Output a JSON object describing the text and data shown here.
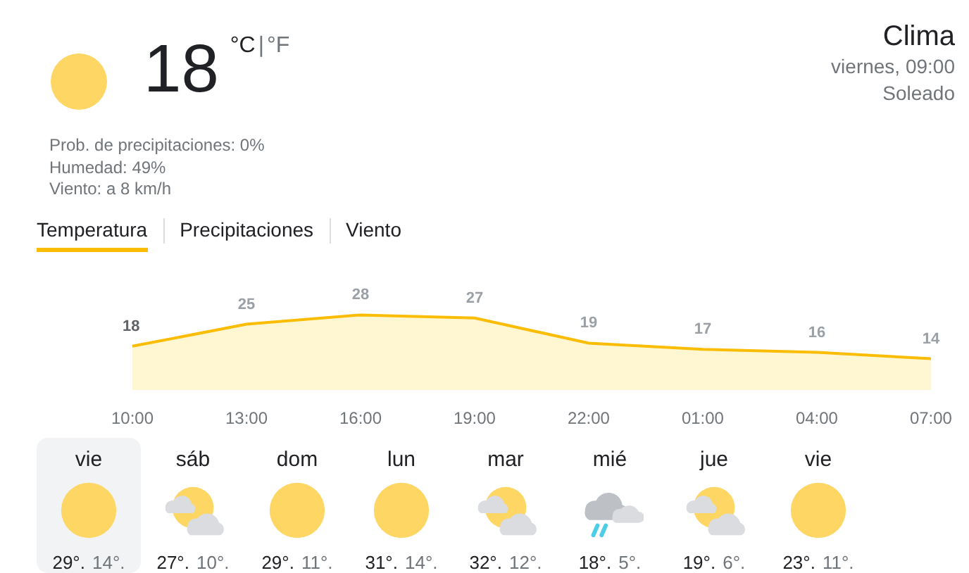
{
  "current": {
    "kind": "sun",
    "temperature": "18",
    "unit_c": "°C",
    "separator": "|",
    "unit_f": "°F",
    "details": [
      "Prob. de precipitaciones: 0%",
      "Humedad: 49%",
      "Viento: a 8 km/h"
    ]
  },
  "location": {
    "title": "Clima",
    "time": "viernes, 09:00",
    "condition": "Soleado"
  },
  "tabs": [
    {
      "label": "Temperatura",
      "selected": true
    },
    {
      "label": "Precipitaciones",
      "selected": false
    },
    {
      "label": "Viento",
      "selected": false
    }
  ],
  "chart_data": {
    "type": "area",
    "categories": [
      "10:00",
      "13:00",
      "16:00",
      "19:00",
      "22:00",
      "01:00",
      "04:00",
      "07:00"
    ],
    "values": [
      18,
      25,
      28,
      27,
      19,
      17,
      16,
      14
    ],
    "data_labels": true
  },
  "days": [
    {
      "day": "vie",
      "kind": "sun",
      "high": "29°.",
      "low": "14°.",
      "selected": true
    },
    {
      "day": "sáb",
      "kind": "partly-cloudy",
      "high": "27°.",
      "low": "10°.",
      "selected": false
    },
    {
      "day": "dom",
      "kind": "sun",
      "high": "29°.",
      "low": "11°.",
      "selected": false
    },
    {
      "day": "lun",
      "kind": "sun",
      "high": "31°.",
      "low": "14°.",
      "selected": false
    },
    {
      "day": "mar",
      "kind": "partly-cloudy",
      "high": "32°.",
      "low": "12°.",
      "selected": false
    },
    {
      "day": "mié",
      "kind": "rain",
      "high": "18°.",
      "low": "5°.",
      "selected": false
    },
    {
      "day": "jue",
      "kind": "partly-cloudy",
      "high": "19°.",
      "low": "6°.",
      "selected": false
    },
    {
      "day": "vie",
      "kind": "sun",
      "high": "23°.",
      "low": "11°.",
      "selected": false
    }
  ]
}
